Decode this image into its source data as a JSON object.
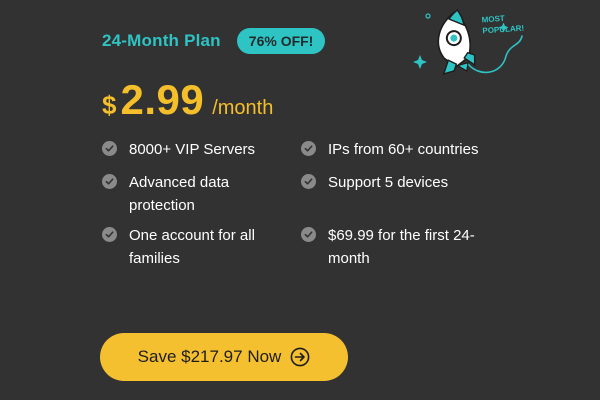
{
  "plan": {
    "title": "24-Month Plan",
    "discount": "76% OFF!"
  },
  "price": {
    "currency": "$",
    "amount": "2.99",
    "period": "/month"
  },
  "badge": {
    "line1": "MOST",
    "line2": "POPULAR!"
  },
  "features": [
    "8000+ VIP Servers",
    "IPs from 60+ countries",
    "Advanced data protection",
    "Support 5 devices",
    "One account for all families",
    "$69.99 for the first 24-month"
  ],
  "cta": {
    "label": "Save $217.97 Now"
  },
  "colors": {
    "background": "#323232",
    "accent_teal": "#2ec4c4",
    "accent_yellow": "#f5bf2b",
    "check_gray": "#8a8a8a"
  },
  "icons": {
    "check": "check-circle-icon",
    "cta": "arrow-right-circle-icon",
    "illustration": "rocket-icon"
  }
}
